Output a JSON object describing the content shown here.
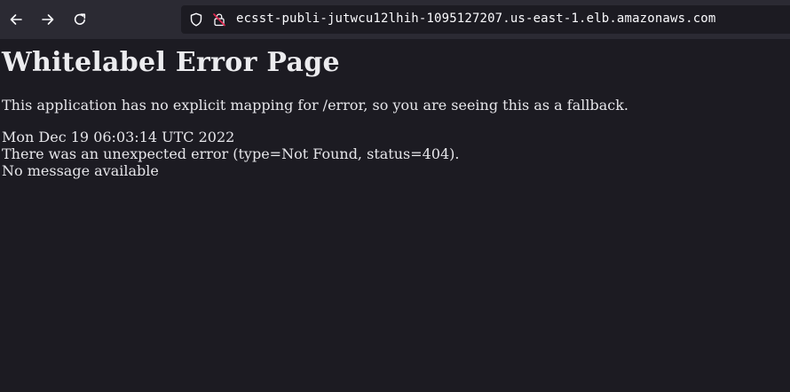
{
  "browser": {
    "url": "ecsst-publi-jutwcu12lhih-1095127207.us-east-1.elb.amazonaws.com",
    "icons": {
      "back": "arrow-left-icon",
      "forward": "arrow-right-icon",
      "reload": "reload-icon",
      "tracking": "shield-icon",
      "security": "insecure-lock-icon"
    },
    "colors": {
      "toolbar": "#2b2a33",
      "urlbar": "#1c1b22",
      "page_background": "#1c1b22",
      "insecure_lock": "#e22850"
    }
  },
  "page": {
    "title": "Whitelabel Error Page",
    "description": "This application has no explicit mapping for /error, so you are seeing this as a fallback.",
    "timestamp": "Mon Dec 19 06:03:14 UTC 2022",
    "error_line": "There was an unexpected error (type=Not Found, status=404).",
    "message": "No message available"
  }
}
